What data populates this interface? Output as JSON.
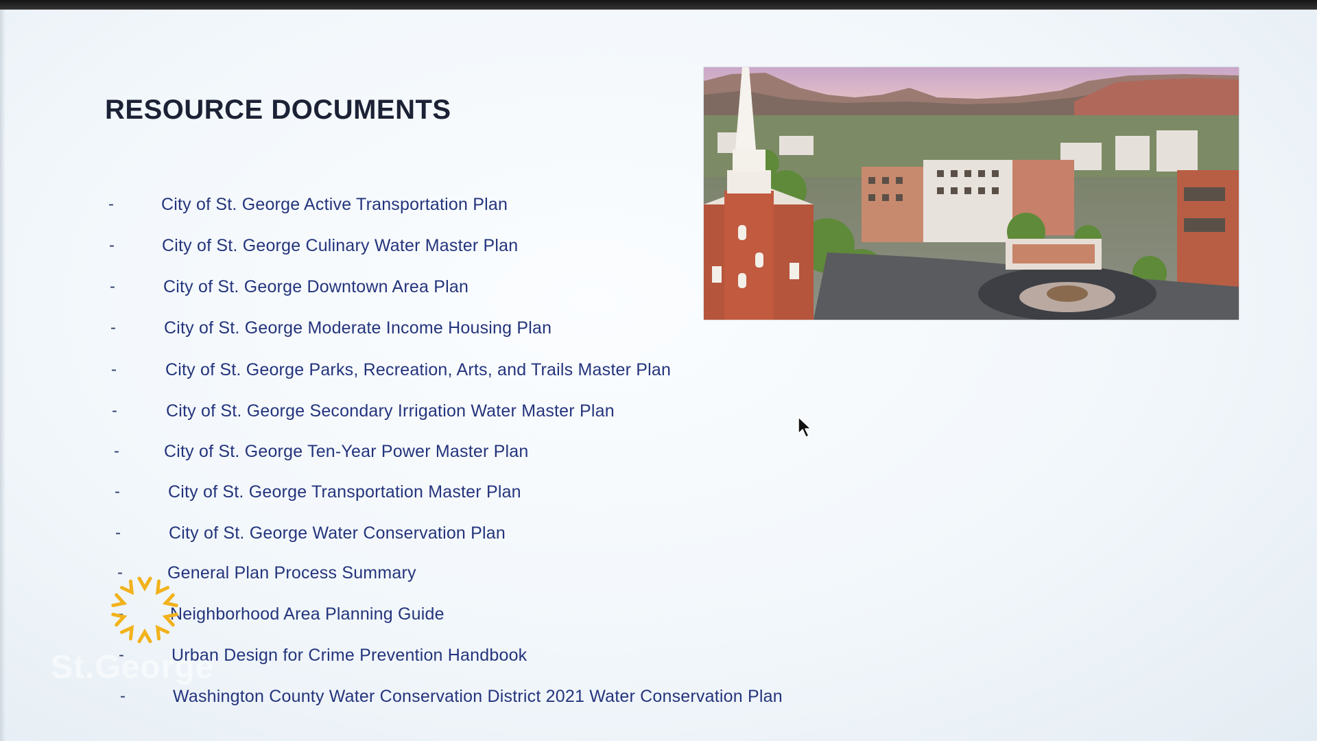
{
  "slide": {
    "title": "RESOURCE DOCUMENTS",
    "bullet_char": "-",
    "documents": [
      "City of St. George Active Transportation Plan",
      "City of St. George Culinary Water Master Plan",
      "City of St. George Downtown Area Plan",
      "City of St. George Moderate Income Housing Plan",
      "City of St. George Parks, Recreation, Arts, and Trails Master Plan",
      "City of St. George Secondary Irrigation Water Master Plan",
      "City of St. George Ten-Year Power Master Plan",
      "City of St. George Transportation Master Plan",
      "City of St. George Water Conservation Plan",
      "General Plan Process Summary",
      "Neighborhood Area Planning Guide",
      "Urban Design for Crime Prevention Handbook",
      "Washington County Water Conservation District 2021 Water Conservation Plan"
    ],
    "photo_icon": "downtown-aerial-photo"
  },
  "overlay": {
    "logo_icon": "sun-logo-icon",
    "watermark_text": "St.George",
    "cursor_icon": "mouse-pointer-icon"
  },
  "colors": {
    "title": "#1c2235",
    "list_text": "#24347c",
    "logo": "#f2b21c"
  }
}
